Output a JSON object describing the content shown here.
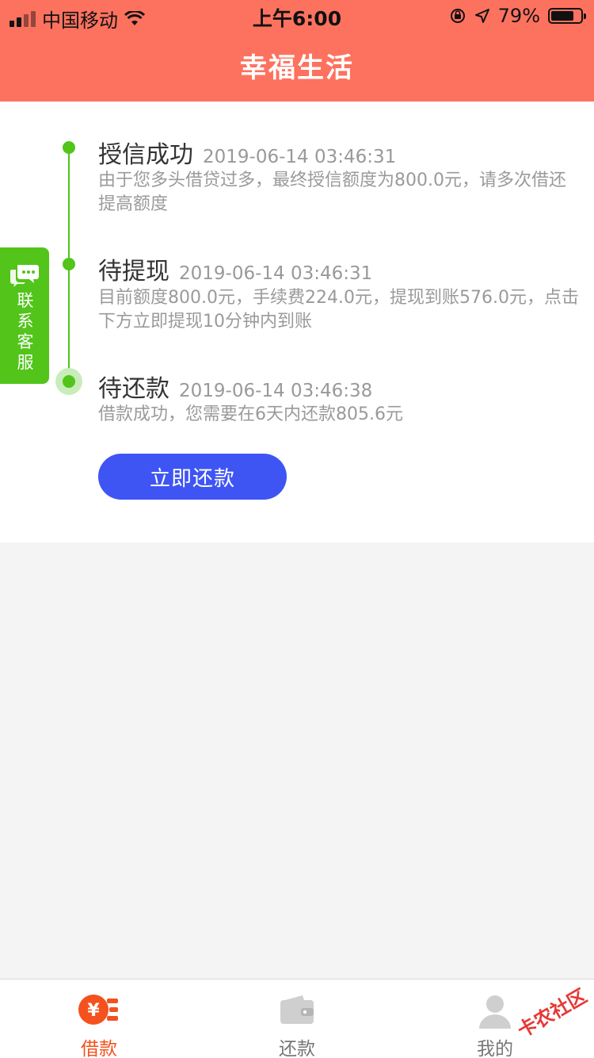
{
  "status_bar": {
    "carrier": "中国移动",
    "time": "上午6:00",
    "battery_percent": "79%",
    "battery_level": 0.79
  },
  "header": {
    "title": "幸福生活",
    "color": "#fd725f"
  },
  "timeline": {
    "accent_color": "#52c41a",
    "steps": [
      {
        "title": "授信成功",
        "time": "2019-06-14 03:46:31",
        "desc": "由于您多头借贷过多，最终授信额度为800.0元，请多次借还提高额度"
      },
      {
        "title": "待提现",
        "time": "2019-06-14 03:46:31",
        "desc": "目前额度800.0元，手续费224.0元，提现到账576.0元，点击下方立即提现10分钟内到账"
      },
      {
        "title": "待还款",
        "time": "2019-06-14 03:46:38",
        "desc": "借款成功，您需要在6天内还款805.6元"
      }
    ]
  },
  "actions": {
    "repay_now": "立即还款",
    "button_color": "#3e55f4"
  },
  "customer_service": {
    "label": "联系客服",
    "icon": "chat-bubble-icon"
  },
  "tabbar": {
    "active_color": "#f4511e",
    "items": [
      {
        "label": "借款",
        "icon": "loan-yen-icon",
        "active": true
      },
      {
        "label": "还款",
        "icon": "wallet-icon",
        "active": false
      },
      {
        "label": "我的",
        "icon": "user-icon",
        "active": false
      }
    ]
  },
  "watermark": "卡农社区"
}
